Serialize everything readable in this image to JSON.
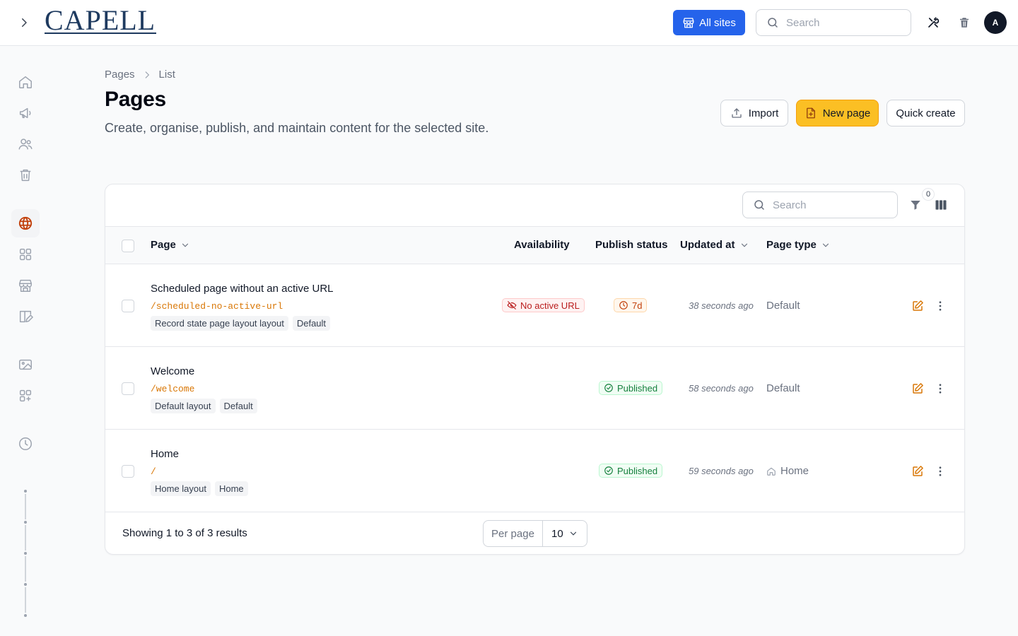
{
  "header": {
    "logo_text": "CAPELL",
    "all_sites_label": "All sites",
    "search_placeholder": "Search",
    "avatar_initial": "A"
  },
  "sidebar": {
    "items": [
      {
        "icon": "home-icon"
      },
      {
        "icon": "megaphone-icon"
      },
      {
        "icon": "users-icon"
      },
      {
        "icon": "trash-icon"
      },
      {
        "icon": "globe-icon",
        "active": true
      },
      {
        "icon": "grid-icon"
      },
      {
        "icon": "storefront-icon"
      },
      {
        "icon": "layout-edit-icon"
      },
      {
        "icon": "image-icon"
      },
      {
        "icon": "add-grid-icon"
      },
      {
        "icon": "clock-icon"
      }
    ]
  },
  "breadcrumb": {
    "root": "Pages",
    "current": "List"
  },
  "page": {
    "title": "Pages",
    "description": "Create, organise, publish, and maintain content for the selected site."
  },
  "actions": {
    "import_label": "Import",
    "new_page_label": "New page",
    "quick_create_label": "Quick create"
  },
  "table": {
    "search_placeholder": "Search",
    "filter_count": "0",
    "columns": {
      "page": "Page",
      "availability": "Availability",
      "publish_status": "Publish status",
      "updated_at": "Updated at",
      "page_type": "Page type"
    },
    "rows": [
      {
        "title": "Scheduled page without an active URL",
        "slug": "/scheduled-no-active-url",
        "tags": [
          "Record state page layout layout",
          "Default"
        ],
        "availability": "No active URL",
        "status": "7d",
        "updated": "38 seconds ago",
        "type": "Default"
      },
      {
        "title": "Welcome",
        "slug": "/welcome",
        "tags": [
          "Default layout",
          "Default"
        ],
        "availability": "",
        "status": "Published",
        "updated": "58 seconds ago",
        "type": "Default"
      },
      {
        "title": "Home",
        "slug": "/",
        "tags": [
          "Home layout",
          "Home"
        ],
        "availability": "",
        "status": "Published",
        "updated": "59 seconds ago",
        "type": "Home"
      }
    ],
    "footer": {
      "showing": "Showing 1 to 3 of 3 results",
      "per_page_label": "Per page",
      "per_page_value": "10"
    }
  },
  "colors": {
    "primary_blue": "#2563eb",
    "accent_amber": "#fbbf24",
    "slug_orange": "#d97706",
    "success_green": "#15803d",
    "danger_red": "#b91c1c"
  }
}
